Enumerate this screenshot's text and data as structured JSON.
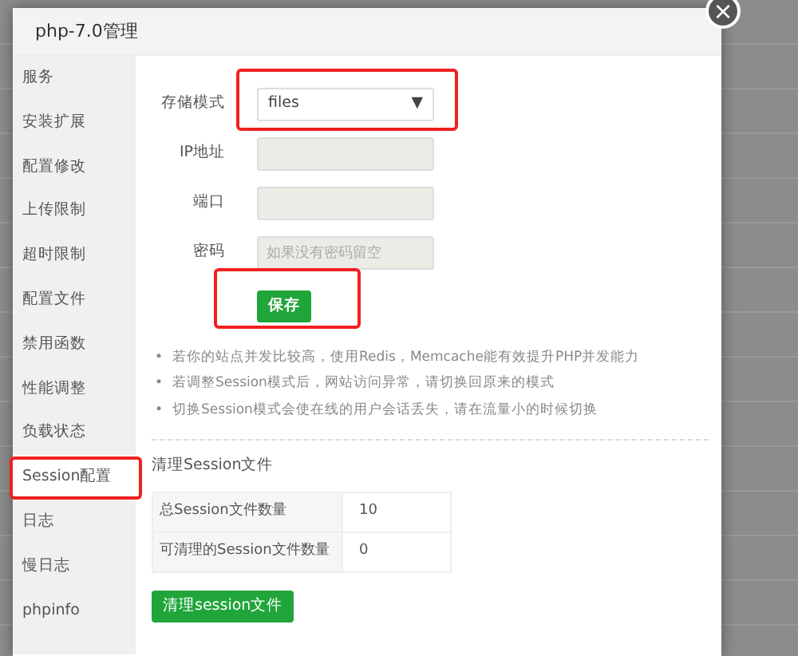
{
  "dialog": {
    "title": "php-7.0管理",
    "close": "×"
  },
  "sidebar": {
    "items": [
      {
        "label": "服务",
        "selected": false,
        "annotated": false
      },
      {
        "label": "安装扩展",
        "selected": false,
        "annotated": false
      },
      {
        "label": "配置修改",
        "selected": false,
        "annotated": false
      },
      {
        "label": "上传限制",
        "selected": false,
        "annotated": false
      },
      {
        "label": "超时限制",
        "selected": false,
        "annotated": false
      },
      {
        "label": "配置文件",
        "selected": false,
        "annotated": false
      },
      {
        "label": "禁用函数",
        "selected": false,
        "annotated": false
      },
      {
        "label": "性能调整",
        "selected": false,
        "annotated": false
      },
      {
        "label": "负载状态",
        "selected": false,
        "annotated": false
      },
      {
        "label": "Session配置",
        "selected": true,
        "annotated": true
      },
      {
        "label": "日志",
        "selected": false,
        "annotated": false
      },
      {
        "label": "慢日志",
        "selected": false,
        "annotated": false
      },
      {
        "label": "phpinfo",
        "selected": false,
        "annotated": false
      }
    ]
  },
  "form": {
    "fields": [
      {
        "kind": "select",
        "label": "存储模式",
        "value": "files",
        "caret": "▼",
        "annotated": true
      },
      {
        "kind": "input",
        "label": "IP地址",
        "disabled": true,
        "annotated": false
      },
      {
        "kind": "input",
        "label": "端口",
        "disabled": true,
        "annotated": false
      },
      {
        "kind": "input",
        "label": "密码",
        "placeholder": "如果没有密码留空",
        "disabled": true,
        "annotated": false
      }
    ],
    "save_button": {
      "label": "保存",
      "annotated": true
    }
  },
  "bullet": "•",
  "notes": [
    "若你的站点并发比较高，使用Redis，Memcache能有效提升PHP并发能力",
    "若调整Session模式后，网站访问异常，请切换回原来的模式",
    "切换Session模式会使在线的用户会话丢失，请在流量小的时候切换"
  ],
  "cleanup": {
    "title": "清理Session文件",
    "rows": [
      {
        "label": "总Session文件数量",
        "value": "10"
      },
      {
        "label": "可清理的Session文件数量",
        "value": "0"
      }
    ],
    "button": "清理session文件"
  }
}
